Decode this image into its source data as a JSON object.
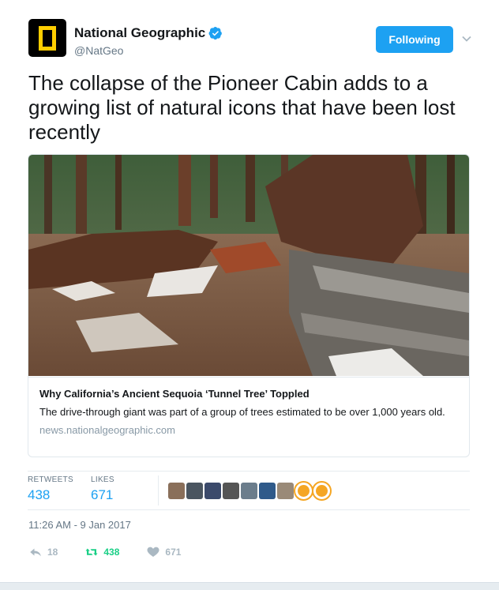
{
  "author": {
    "name": "National Geographic",
    "handle": "@NatGeo",
    "verified": true,
    "avatar_icon": "nat-geo-yellow-frame-logo"
  },
  "follow_button": {
    "label": "Following"
  },
  "tweet": {
    "text": "The collapse of the Pioneer Cabin adds to a growing list of natural icons that have been lost recently"
  },
  "card": {
    "image_alt": "photo-fallen-sequoia",
    "title": "Why California’s Ancient Sequoia ‘Tunnel Tree’ Toppled",
    "description": "The drive-through giant was part of a group of trees estimated to be over 1,000 years old.",
    "domain": "news.nationalgeographic.com"
  },
  "stats": {
    "retweets_label": "RETWEETS",
    "retweets_value": "438",
    "likes_label": "LIKES",
    "likes_value": "671"
  },
  "likers": [
    "#8a6f5a",
    "#4a5560",
    "#3b4a6b",
    "#555555",
    "#6b7d8c",
    "#2f5a8a",
    "#9a8a78",
    "#f5a623",
    "#f5a623"
  ],
  "timestamp": "11:26 AM - 9 Jan 2017",
  "actions": {
    "reply_count": "18",
    "retweet_count": "438",
    "like_count": "671"
  },
  "colors": {
    "accent": "#1da1f2",
    "retweet": "#19cf86",
    "muted": "#aab8c2",
    "brand_yellow": "#ffce00"
  }
}
